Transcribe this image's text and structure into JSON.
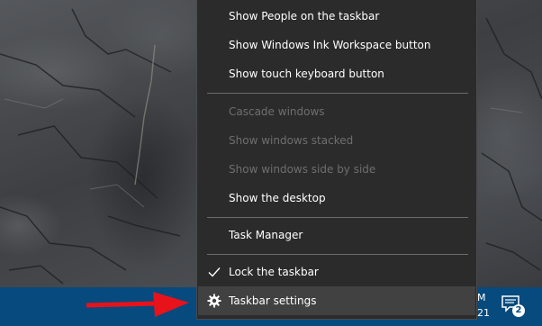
{
  "context_menu": {
    "items": [
      {
        "label": "Show People on the taskbar",
        "enabled": true
      },
      {
        "label": "Show Windows Ink Workspace button",
        "enabled": true
      },
      {
        "label": "Show touch keyboard button",
        "enabled": true
      },
      {
        "label": "Cascade windows",
        "enabled": false
      },
      {
        "label": "Show windows stacked",
        "enabled": false
      },
      {
        "label": "Show windows side by side",
        "enabled": false
      },
      {
        "label": "Show the desktop",
        "enabled": true
      },
      {
        "label": "Task Manager",
        "enabled": true
      },
      {
        "label": "Lock the taskbar",
        "enabled": true,
        "checked": true,
        "icon": "checkmark-icon"
      },
      {
        "label": "Taskbar settings",
        "enabled": true,
        "hovered": true,
        "icon": "gear-icon"
      }
    ]
  },
  "taskbar": {
    "clock_line1": "M",
    "clock_line2": "21",
    "notification_count": "2",
    "notification_icon": "action-center-icon",
    "color": "#064a7e"
  },
  "annotation": {
    "arrow_color": "#e8121a",
    "arrow_icon": "red-arrow-icon"
  }
}
